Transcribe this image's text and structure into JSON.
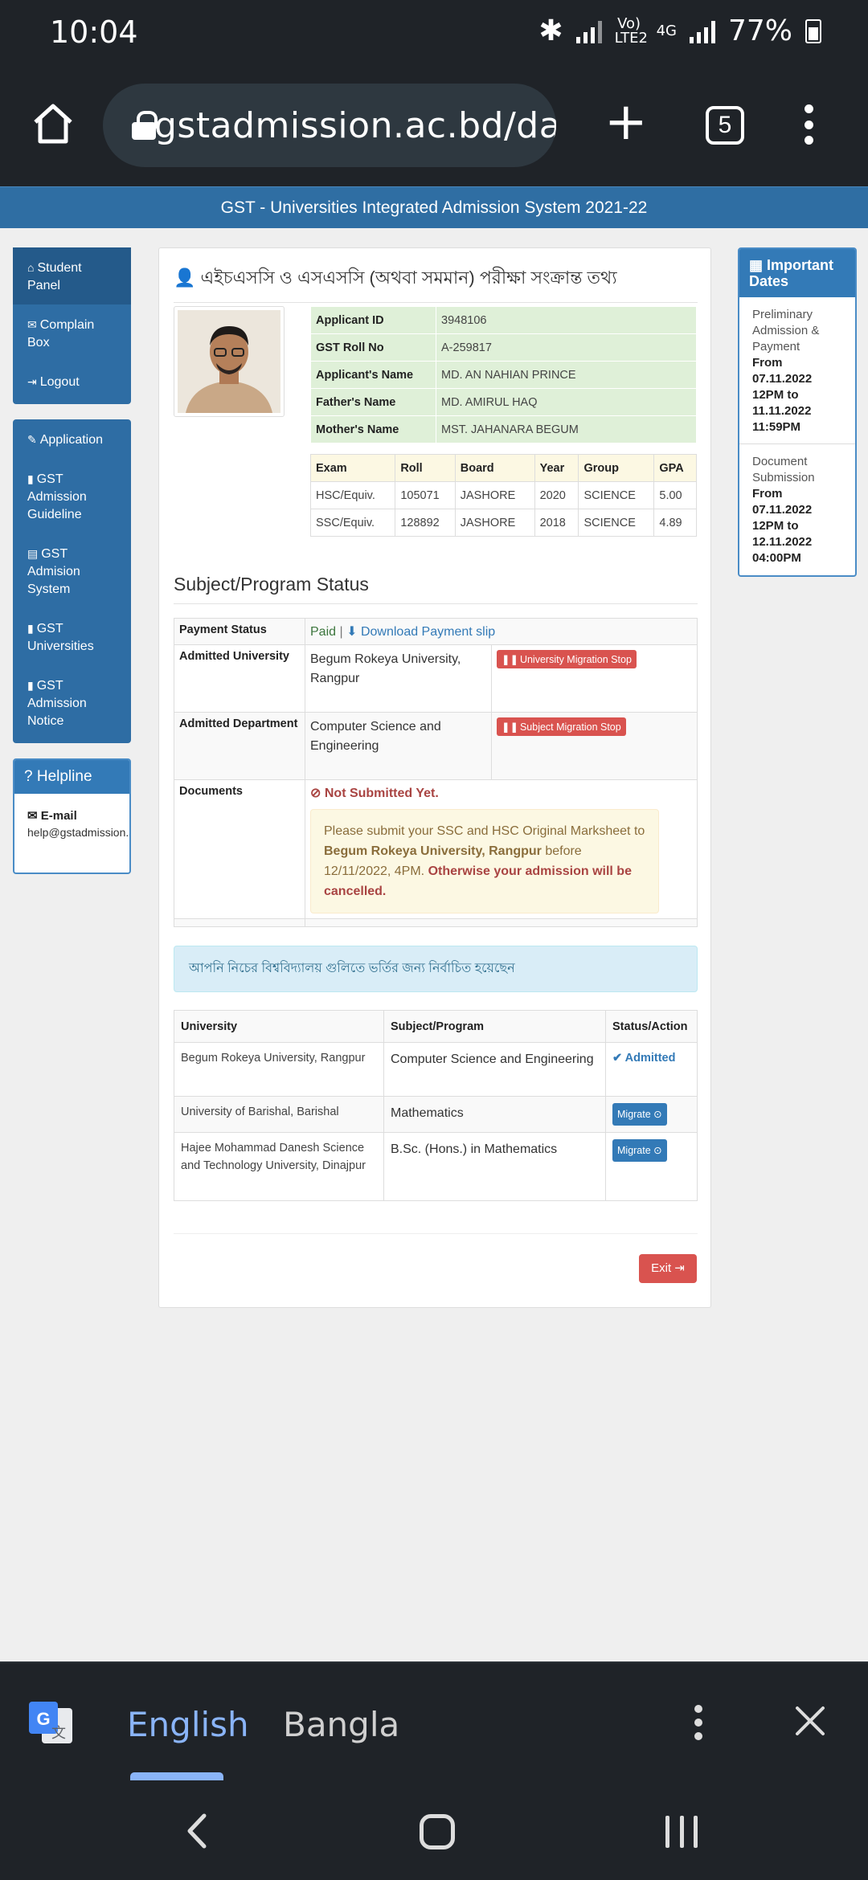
{
  "status_bar": {
    "time": "10:04",
    "network_label": "Vo) LTE2",
    "network_type": "4G",
    "battery": "77%"
  },
  "browser": {
    "url": "gstadmission.ac.bd/da",
    "tab_count": "5"
  },
  "site": {
    "header_title": "GST - Universities Integrated Admission System 2021-22"
  },
  "sidebar": {
    "panel1": [
      {
        "label": "Student Panel",
        "icon": "home-icon"
      },
      {
        "label": "Complain Box",
        "icon": "envelope-icon"
      },
      {
        "label": "Logout",
        "icon": "logout-icon"
      }
    ],
    "panel2": [
      {
        "label": "Application",
        "icon": "edit-icon"
      },
      {
        "label": "GST Admission Guideline",
        "icon": "book-icon"
      },
      {
        "label": "GST Admision System",
        "icon": "file-icon"
      },
      {
        "label": "GST Universities",
        "icon": "book-icon"
      },
      {
        "label": "GST Admission Notice",
        "icon": "book-icon"
      }
    ],
    "helpline": {
      "title": "Helpline",
      "email_label": "E-mail",
      "email": "help@gstadmission.ac.bd"
    }
  },
  "main": {
    "title": "এইচএসসি ও এসএসসি (অথবা সমমান) পরীক্ষা সংক্রান্ত তথ্য",
    "applicant": [
      {
        "key": "Applicant ID",
        "value": "3948106"
      },
      {
        "key": "GST Roll No",
        "value": "A-259817"
      },
      {
        "key": "Applicant's Name",
        "value": "MD. AN NAHIAN PRINCE"
      },
      {
        "key": "Father's Name",
        "value": "MD. AMIRUL HAQ"
      },
      {
        "key": "Mother's Name",
        "value": "MST. JAHANARA BEGUM"
      }
    ],
    "exam_headers": [
      "Exam",
      "Roll",
      "Board",
      "Year",
      "Group",
      "GPA"
    ],
    "exams": [
      [
        "HSC/Equiv.",
        "105071",
        "JASHORE",
        "2020",
        "SCIENCE",
        "5.00"
      ],
      [
        "SSC/Equiv.",
        "128892",
        "JASHORE",
        "2018",
        "SCIENCE",
        "4.89"
      ]
    ],
    "status_title": "Subject/Program Status",
    "payment": {
      "label": "Payment Status",
      "status": "Paid",
      "separator": "|",
      "download_link": "Download Payment slip"
    },
    "admitted_university": {
      "label": "Admitted University",
      "value": "Begum Rokeya University, Rangpur",
      "badge": "University Migration Stop"
    },
    "admitted_department": {
      "label": "Admitted Department",
      "value": "Computer Science and Engineering",
      "badge": "Subject Migration Stop"
    },
    "documents": {
      "label": "Documents",
      "status": "Not Submitted Yet.",
      "msg_part1": "Please submit your SSC and HSC Original Marksheet to ",
      "msg_university": "Begum Rokeya University, Rangpur",
      "msg_part2": " before 12/11/2022, 4PM. ",
      "msg_warning": "Otherwise your admission will be cancelled."
    },
    "selected_alert": "আপনি নিচের বিশ্ববিদ্যালয় গুলিতে ভর্তির জন্য নির্বাচিত হয়েছেন",
    "uni_headers": [
      "University",
      "Subject/Program",
      "Status/Action"
    ],
    "universities": [
      {
        "university": "Begum Rokeya University, Rangpur",
        "program": "Computer Science and Engineering",
        "action": "Admitted"
      },
      {
        "university": "University of Barishal, Barishal",
        "program": "Mathematics",
        "action": "Migrate"
      },
      {
        "university": "Hajee Mohammad Danesh Science and Technology University, Dinajpur",
        "program": "B.Sc. (Hons.) in Mathematics",
        "action": "Migrate"
      }
    ],
    "exit_label": "Exit"
  },
  "important_dates": {
    "title": "Important Dates",
    "entries": [
      {
        "event": "Preliminary Admission & Payment",
        "from_label": "From",
        "from": "07.11.2022 12PM to",
        "to": "11.11.2022 11:59PM"
      },
      {
        "event": "Document Submission",
        "from_label": "From",
        "from": "07.11.2022 12PM to",
        "to": "12.11.2022 04:00PM"
      }
    ]
  },
  "translate_bar": {
    "lang_1": "English",
    "lang_2": "Bangla"
  },
  "colors": {
    "primary": "#337ab7",
    "danger": "#d9534f",
    "success_bg": "#dff0d8",
    "warning_bg": "#fcf8e3",
    "info_bg": "#d9edf7"
  }
}
